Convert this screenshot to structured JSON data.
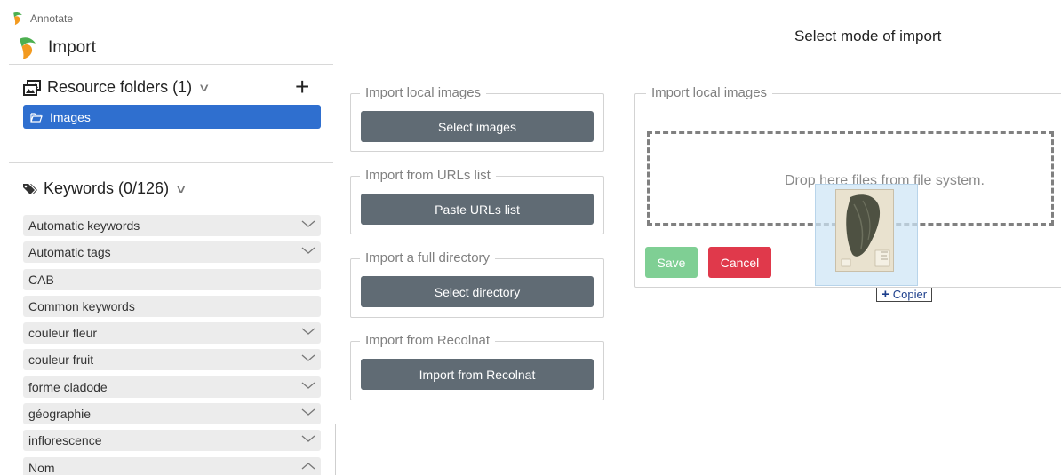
{
  "app": {
    "name": "Annotate"
  },
  "page": {
    "title": "Import"
  },
  "sidebar": {
    "resource_folders": {
      "title": "Resource folders (1)",
      "items": [
        {
          "label": "Images",
          "selected": true
        }
      ]
    },
    "keywords": {
      "title": "Keywords (0/126)",
      "items": [
        {
          "label": "Automatic keywords",
          "expand": "down"
        },
        {
          "label": "Automatic tags",
          "expand": "down"
        },
        {
          "label": "CAB",
          "expand": "none"
        },
        {
          "label": "Common keywords",
          "expand": "none"
        },
        {
          "label": "couleur fleur",
          "expand": "down"
        },
        {
          "label": "couleur fruit",
          "expand": "down"
        },
        {
          "label": "forme cladode",
          "expand": "down"
        },
        {
          "label": "géographie",
          "expand": "down"
        },
        {
          "label": "inflorescence",
          "expand": "down"
        },
        {
          "label": "Nom",
          "expand": "up"
        }
      ]
    }
  },
  "import_modes": {
    "local": {
      "legend": "Import local images",
      "button": "Select images"
    },
    "urls": {
      "legend": "Import from URLs list",
      "button": "Paste URLs list"
    },
    "directory": {
      "legend": "Import a full directory",
      "button": "Select directory"
    },
    "recolnat": {
      "legend": "Import from Recolnat",
      "button": "Import from Recolnat"
    }
  },
  "main": {
    "title": "Select mode of import",
    "local_panel": {
      "legend": "Import local images",
      "drop_text": "Drop here files from file system.",
      "save_label": "Save",
      "cancel_label": "Cancel"
    },
    "drag_tooltip": "Copier"
  },
  "colors": {
    "selected_folder": "#2f6fcf",
    "action_button": "#606b74",
    "save_button": "#7fcf94",
    "cancel_button": "#e0394b",
    "logo_green": "#4caf50",
    "logo_orange": "#f39a1f"
  },
  "icons": {
    "logo": "annotate-logo-icon",
    "folders": "image-folders-icon",
    "folder": "folder-open-icon",
    "tags": "tags-icon",
    "add": "plus-icon",
    "chevron_down": "chevron-down-icon",
    "chevron_up": "chevron-up-icon"
  }
}
